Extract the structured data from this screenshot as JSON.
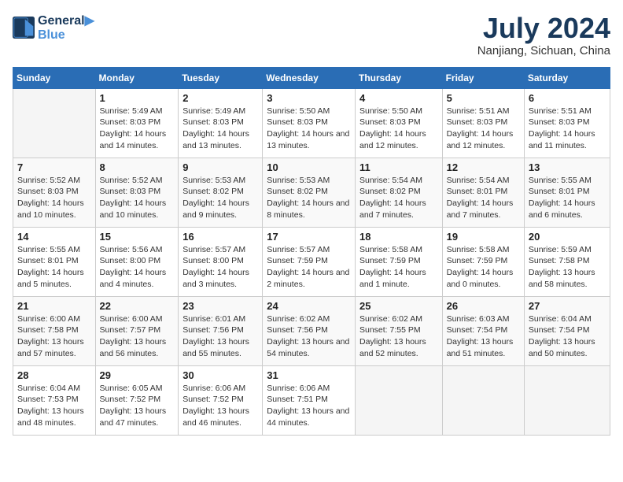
{
  "header": {
    "logo_line1": "General",
    "logo_line2": "Blue",
    "month": "July 2024",
    "location": "Nanjiang, Sichuan, China"
  },
  "weekdays": [
    "Sunday",
    "Monday",
    "Tuesday",
    "Wednesday",
    "Thursday",
    "Friday",
    "Saturday"
  ],
  "weeks": [
    [
      {
        "day": "",
        "empty": true
      },
      {
        "day": "1",
        "sunrise": "5:49 AM",
        "sunset": "8:03 PM",
        "daylight": "14 hours and 14 minutes."
      },
      {
        "day": "2",
        "sunrise": "5:49 AM",
        "sunset": "8:03 PM",
        "daylight": "14 hours and 13 minutes."
      },
      {
        "day": "3",
        "sunrise": "5:50 AM",
        "sunset": "8:03 PM",
        "daylight": "14 hours and 13 minutes."
      },
      {
        "day": "4",
        "sunrise": "5:50 AM",
        "sunset": "8:03 PM",
        "daylight": "14 hours and 12 minutes."
      },
      {
        "day": "5",
        "sunrise": "5:51 AM",
        "sunset": "8:03 PM",
        "daylight": "14 hours and 12 minutes."
      },
      {
        "day": "6",
        "sunrise": "5:51 AM",
        "sunset": "8:03 PM",
        "daylight": "14 hours and 11 minutes."
      }
    ],
    [
      {
        "day": "7",
        "sunrise": "5:52 AM",
        "sunset": "8:03 PM",
        "daylight": "14 hours and 10 minutes."
      },
      {
        "day": "8",
        "sunrise": "5:52 AM",
        "sunset": "8:03 PM",
        "daylight": "14 hours and 10 minutes."
      },
      {
        "day": "9",
        "sunrise": "5:53 AM",
        "sunset": "8:02 PM",
        "daylight": "14 hours and 9 minutes."
      },
      {
        "day": "10",
        "sunrise": "5:53 AM",
        "sunset": "8:02 PM",
        "daylight": "14 hours and 8 minutes."
      },
      {
        "day": "11",
        "sunrise": "5:54 AM",
        "sunset": "8:02 PM",
        "daylight": "14 hours and 7 minutes."
      },
      {
        "day": "12",
        "sunrise": "5:54 AM",
        "sunset": "8:01 PM",
        "daylight": "14 hours and 7 minutes."
      },
      {
        "day": "13",
        "sunrise": "5:55 AM",
        "sunset": "8:01 PM",
        "daylight": "14 hours and 6 minutes."
      }
    ],
    [
      {
        "day": "14",
        "sunrise": "5:55 AM",
        "sunset": "8:01 PM",
        "daylight": "14 hours and 5 minutes."
      },
      {
        "day": "15",
        "sunrise": "5:56 AM",
        "sunset": "8:00 PM",
        "daylight": "14 hours and 4 minutes."
      },
      {
        "day": "16",
        "sunrise": "5:57 AM",
        "sunset": "8:00 PM",
        "daylight": "14 hours and 3 minutes."
      },
      {
        "day": "17",
        "sunrise": "5:57 AM",
        "sunset": "7:59 PM",
        "daylight": "14 hours and 2 minutes."
      },
      {
        "day": "18",
        "sunrise": "5:58 AM",
        "sunset": "7:59 PM",
        "daylight": "14 hours and 1 minute."
      },
      {
        "day": "19",
        "sunrise": "5:58 AM",
        "sunset": "7:59 PM",
        "daylight": "14 hours and 0 minutes."
      },
      {
        "day": "20",
        "sunrise": "5:59 AM",
        "sunset": "7:58 PM",
        "daylight": "13 hours and 58 minutes."
      }
    ],
    [
      {
        "day": "21",
        "sunrise": "6:00 AM",
        "sunset": "7:58 PM",
        "daylight": "13 hours and 57 minutes."
      },
      {
        "day": "22",
        "sunrise": "6:00 AM",
        "sunset": "7:57 PM",
        "daylight": "13 hours and 56 minutes."
      },
      {
        "day": "23",
        "sunrise": "6:01 AM",
        "sunset": "7:56 PM",
        "daylight": "13 hours and 55 minutes."
      },
      {
        "day": "24",
        "sunrise": "6:02 AM",
        "sunset": "7:56 PM",
        "daylight": "13 hours and 54 minutes."
      },
      {
        "day": "25",
        "sunrise": "6:02 AM",
        "sunset": "7:55 PM",
        "daylight": "13 hours and 52 minutes."
      },
      {
        "day": "26",
        "sunrise": "6:03 AM",
        "sunset": "7:54 PM",
        "daylight": "13 hours and 51 minutes."
      },
      {
        "day": "27",
        "sunrise": "6:04 AM",
        "sunset": "7:54 PM",
        "daylight": "13 hours and 50 minutes."
      }
    ],
    [
      {
        "day": "28",
        "sunrise": "6:04 AM",
        "sunset": "7:53 PM",
        "daylight": "13 hours and 48 minutes."
      },
      {
        "day": "29",
        "sunrise": "6:05 AM",
        "sunset": "7:52 PM",
        "daylight": "13 hours and 47 minutes."
      },
      {
        "day": "30",
        "sunrise": "6:06 AM",
        "sunset": "7:52 PM",
        "daylight": "13 hours and 46 minutes."
      },
      {
        "day": "31",
        "sunrise": "6:06 AM",
        "sunset": "7:51 PM",
        "daylight": "13 hours and 44 minutes."
      },
      {
        "day": "",
        "empty": true
      },
      {
        "day": "",
        "empty": true
      },
      {
        "day": "",
        "empty": true
      }
    ]
  ]
}
